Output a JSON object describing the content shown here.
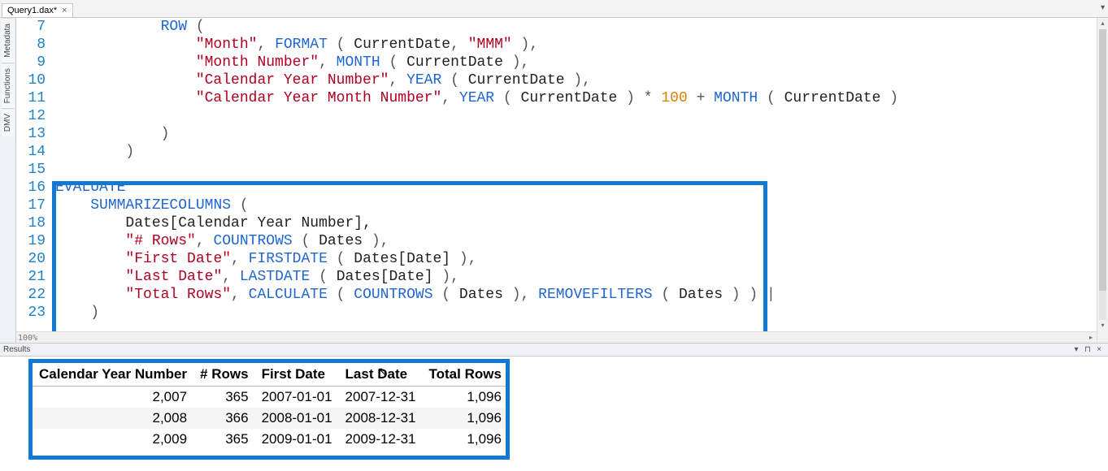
{
  "tab": {
    "title": "Query1.dax*",
    "close": "×"
  },
  "tabstrip": {
    "dropdown": "▾"
  },
  "sidetabs": [
    "Metadata",
    "Functions",
    "DMV"
  ],
  "editor_status": "100%",
  "scroll": {
    "up": "▴",
    "down": "▾",
    "right": "▸"
  },
  "code": {
    "lines": [
      {
        "n": "7",
        "tokens": [
          {
            "t": "            ",
            "c": "id"
          },
          {
            "t": "ROW",
            "c": "kw"
          },
          {
            "t": " (",
            "c": "punc"
          }
        ]
      },
      {
        "n": "8",
        "tokens": [
          {
            "t": "                ",
            "c": "id"
          },
          {
            "t": "\"Month\"",
            "c": "str"
          },
          {
            "t": ", ",
            "c": "punc"
          },
          {
            "t": "FORMAT",
            "c": "fn"
          },
          {
            "t": " ( ",
            "c": "punc"
          },
          {
            "t": "CurrentDate",
            "c": "id"
          },
          {
            "t": ", ",
            "c": "punc"
          },
          {
            "t": "\"MMM\"",
            "c": "str"
          },
          {
            "t": " ),",
            "c": "punc"
          }
        ]
      },
      {
        "n": "9",
        "tokens": [
          {
            "t": "                ",
            "c": "id"
          },
          {
            "t": "\"Month Number\"",
            "c": "str"
          },
          {
            "t": ", ",
            "c": "punc"
          },
          {
            "t": "MONTH",
            "c": "fn"
          },
          {
            "t": " ( ",
            "c": "punc"
          },
          {
            "t": "CurrentDate",
            "c": "id"
          },
          {
            "t": " ),",
            "c": "punc"
          }
        ]
      },
      {
        "n": "10",
        "tokens": [
          {
            "t": "                ",
            "c": "id"
          },
          {
            "t": "\"Calendar Year Number\"",
            "c": "str"
          },
          {
            "t": ", ",
            "c": "punc"
          },
          {
            "t": "YEAR",
            "c": "fn"
          },
          {
            "t": " ( ",
            "c": "punc"
          },
          {
            "t": "CurrentDate",
            "c": "id"
          },
          {
            "t": " ),",
            "c": "punc"
          }
        ]
      },
      {
        "n": "11",
        "tokens": [
          {
            "t": "                ",
            "c": "id"
          },
          {
            "t": "\"Calendar Year Month Number\"",
            "c": "str"
          },
          {
            "t": ", ",
            "c": "punc"
          },
          {
            "t": "YEAR",
            "c": "fn"
          },
          {
            "t": " ( ",
            "c": "punc"
          },
          {
            "t": "CurrentDate",
            "c": "id"
          },
          {
            "t": " ) * ",
            "c": "punc"
          },
          {
            "t": "100",
            "c": "num"
          },
          {
            "t": " + ",
            "c": "punc"
          },
          {
            "t": "MONTH",
            "c": "fn"
          },
          {
            "t": " ( ",
            "c": "punc"
          },
          {
            "t": "CurrentDate",
            "c": "id"
          },
          {
            "t": " )",
            "c": "punc"
          }
        ]
      },
      {
        "n": "12",
        "tokens": [
          {
            "t": "",
            "c": "id"
          }
        ]
      },
      {
        "n": "13",
        "tokens": [
          {
            "t": "            )",
            "c": "punc"
          }
        ]
      },
      {
        "n": "14",
        "tokens": [
          {
            "t": "        )",
            "c": "punc"
          }
        ]
      },
      {
        "n": "15",
        "tokens": [
          {
            "t": "",
            "c": "id"
          }
        ]
      },
      {
        "n": "16",
        "tokens": [
          {
            "t": "EVALUATE",
            "c": "kw"
          }
        ]
      },
      {
        "n": "17",
        "tokens": [
          {
            "t": "    ",
            "c": "id"
          },
          {
            "t": "SUMMARIZECOLUMNS",
            "c": "fn"
          },
          {
            "t": " (",
            "c": "punc"
          }
        ]
      },
      {
        "n": "18",
        "tokens": [
          {
            "t": "        ",
            "c": "id"
          },
          {
            "t": "Dates[Calendar Year Number],",
            "c": "id"
          }
        ]
      },
      {
        "n": "19",
        "tokens": [
          {
            "t": "        ",
            "c": "id"
          },
          {
            "t": "\"# Rows\"",
            "c": "str"
          },
          {
            "t": ", ",
            "c": "punc"
          },
          {
            "t": "COUNTROWS",
            "c": "fn"
          },
          {
            "t": " ( ",
            "c": "punc"
          },
          {
            "t": "Dates",
            "c": "id"
          },
          {
            "t": " ),",
            "c": "punc"
          }
        ]
      },
      {
        "n": "20",
        "tokens": [
          {
            "t": "        ",
            "c": "id"
          },
          {
            "t": "\"First Date\"",
            "c": "str"
          },
          {
            "t": ", ",
            "c": "punc"
          },
          {
            "t": "FIRSTDATE",
            "c": "fn"
          },
          {
            "t": " ( ",
            "c": "punc"
          },
          {
            "t": "Dates[Date]",
            "c": "id"
          },
          {
            "t": " ),",
            "c": "punc"
          }
        ]
      },
      {
        "n": "21",
        "tokens": [
          {
            "t": "        ",
            "c": "id"
          },
          {
            "t": "\"Last Date\"",
            "c": "str"
          },
          {
            "t": ", ",
            "c": "punc"
          },
          {
            "t": "LASTDATE",
            "c": "fn"
          },
          {
            "t": " ( ",
            "c": "punc"
          },
          {
            "t": "Dates[Date]",
            "c": "id"
          },
          {
            "t": " ),",
            "c": "punc"
          }
        ]
      },
      {
        "n": "22",
        "tokens": [
          {
            "t": "        ",
            "c": "id"
          },
          {
            "t": "\"Total Rows\"",
            "c": "str"
          },
          {
            "t": ", ",
            "c": "punc"
          },
          {
            "t": "CALCULATE",
            "c": "fn"
          },
          {
            "t": " ( ",
            "c": "punc"
          },
          {
            "t": "COUNTROWS",
            "c": "fn"
          },
          {
            "t": " ( ",
            "c": "punc"
          },
          {
            "t": "Dates",
            "c": "id"
          },
          {
            "t": " ), ",
            "c": "punc"
          },
          {
            "t": "REMOVEFILTERS",
            "c": "fn"
          },
          {
            "t": " ( ",
            "c": "punc"
          },
          {
            "t": "Dates",
            "c": "id"
          },
          {
            "t": " ) ) |",
            "c": "punc"
          }
        ]
      },
      {
        "n": "23",
        "tokens": [
          {
            "t": "    )",
            "c": "punc"
          }
        ]
      }
    ]
  },
  "results": {
    "title": "Results",
    "dropdown": "▾",
    "pin": "⊓",
    "close": "×",
    "headers": [
      "Calendar Year Number",
      "# Rows",
      "First Date",
      "Last Date",
      "Total Rows"
    ],
    "rows": [
      {
        "cyn": "2,007",
        "rows": "365",
        "fd": "2007-01-01",
        "ld": "2007-12-31",
        "tr": "1,096"
      },
      {
        "cyn": "2,008",
        "rows": "366",
        "fd": "2008-01-01",
        "ld": "2008-12-31",
        "tr": "1,096"
      },
      {
        "cyn": "2,009",
        "rows": "365",
        "fd": "2009-01-01",
        "ld": "2009-12-31",
        "tr": "1,096"
      }
    ]
  },
  "chart_data": {
    "type": "table",
    "title": "Results",
    "headers": [
      "Calendar Year Number",
      "# Rows",
      "First Date",
      "Last Date",
      "Total Rows"
    ],
    "rows": [
      [
        2007,
        365,
        "2007-01-01",
        "2007-12-31",
        1096
      ],
      [
        2008,
        366,
        "2008-01-01",
        "2008-12-31",
        1096
      ],
      [
        2009,
        365,
        "2009-01-01",
        "2009-12-31",
        1096
      ]
    ]
  }
}
